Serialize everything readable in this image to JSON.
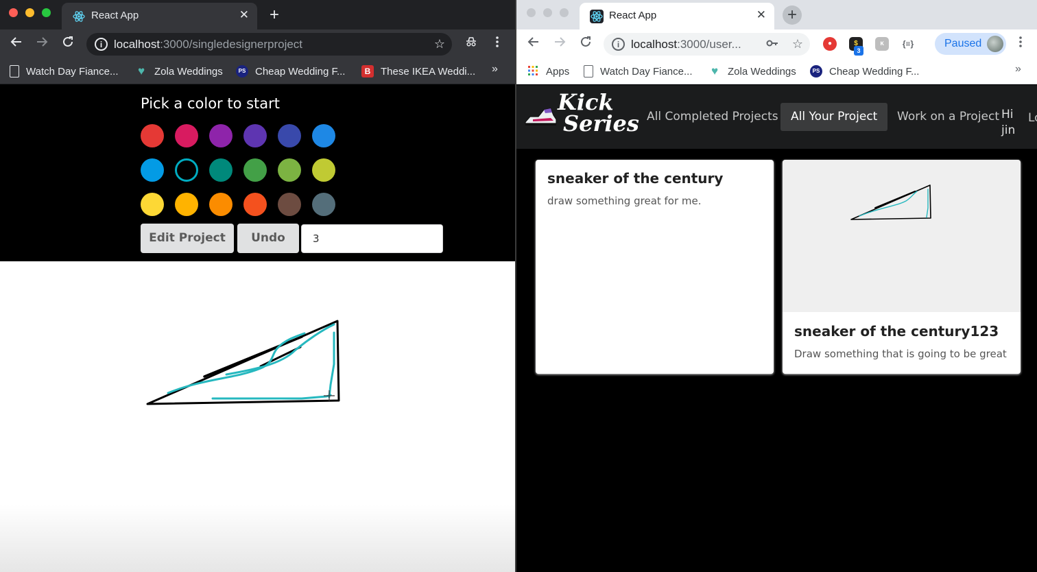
{
  "left_window": {
    "tab": {
      "title": "React App",
      "close": "✕"
    },
    "new_tab": "+",
    "url": {
      "host": "localhost",
      "path": ":3000/singledesignerproject"
    },
    "bookmarks": [
      {
        "label": "Watch Day Fiance...",
        "icon": "page-icon"
      },
      {
        "label": "Zola Weddings",
        "icon": "zola-heart-icon"
      },
      {
        "label": "Cheap Wedding F...",
        "icon": "ps-icon"
      },
      {
        "label": "These IKEA Weddi...",
        "icon": "b-icon"
      }
    ],
    "bookmarks_more": "»",
    "page": {
      "pick_title": "Pick a color to start",
      "swatches": [
        "#e53935",
        "#d81b60",
        "#8e24aa",
        "#5e35b1",
        "#3949ab",
        "#1e88e5",
        "#039be5",
        "#00acc1",
        "#00897b",
        "#43a047",
        "#7cb342",
        "#c0ca33",
        "#fdd835",
        "#ffb300",
        "#fb8c00",
        "#f4511e",
        "#6d4c41",
        "#546e7a"
      ],
      "selected_swatch": 7,
      "edit_button": "Edit Project",
      "undo_button": "Undo",
      "stroke_width_value": "3"
    }
  },
  "right_window": {
    "tab": {
      "title": "React App",
      "close": "✕"
    },
    "new_tab": "+",
    "url": {
      "host": "localhost",
      "path": ":3000/user..."
    },
    "paused_label": "Paused",
    "extension_badge": "3",
    "bookmarks": [
      {
        "label": "Apps",
        "icon": "apps-grid-icon"
      },
      {
        "label": "Watch Day Fiance...",
        "icon": "page-icon"
      },
      {
        "label": "Zola Weddings",
        "icon": "zola-heart-icon"
      },
      {
        "label": "Cheap Wedding F...",
        "icon": "ps-icon"
      }
    ],
    "bookmarks_more": "»",
    "app": {
      "logo_line1": "Kick",
      "logo_line2": "Series",
      "nav": [
        {
          "label": "All Completed Projects",
          "active": false
        },
        {
          "label": "All Your Project",
          "active": true
        },
        {
          "label": "Work on a Project",
          "active": false
        }
      ],
      "greeting": "Hi jin",
      "logout_partial": "Lo"
    },
    "cards": [
      {
        "title": "sneaker of the century",
        "description": "draw something great for me.",
        "has_image": false
      },
      {
        "title": "sneaker of the century123",
        "description": "Draw something that is going to be great",
        "has_image": true
      }
    ]
  }
}
